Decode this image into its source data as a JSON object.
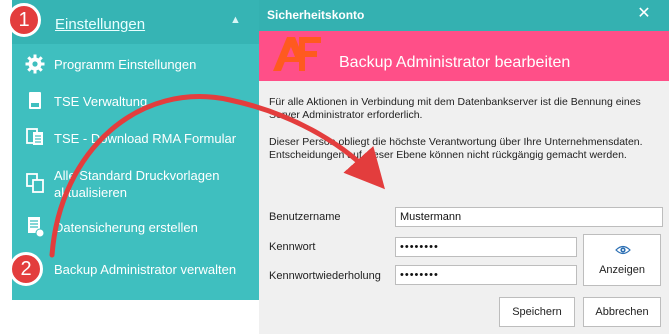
{
  "sidebar": {
    "section_label": "Einstellungen",
    "collapse_icon": "chevron-up-icon",
    "items": [
      {
        "label": "Programm Einstellungen",
        "icon": "gear-icon"
      },
      {
        "label": "TSE Verwaltung",
        "icon": "tse-chip-icon"
      },
      {
        "label": "TSE - Download RMA Formular",
        "icon": "form-download-icon"
      },
      {
        "label": "Alle Standard Druckvorlagen aktualisieren",
        "icon": "copy-templates-icon"
      },
      {
        "label": "Datensicherung erstellen",
        "icon": "backup-document-icon"
      },
      {
        "label": "Backup Administrator verwalten",
        "icon": "database-user-icon"
      }
    ]
  },
  "dialog": {
    "title": "Sicherheitskonto",
    "close_glyph": "✕",
    "banner_title": "Backup Administrator bearbeiten",
    "logo_icon": "af-logo",
    "info_line1": "Für alle Aktionen in Verbindung mit dem Datenbankserver ist die Bennung eines Server Administrator erforderlich.",
    "info_line2": "Dieser Person obliegt die höchste Verantwortung über Ihre Unternehmensdaten. Entscheidungen auf dieser Ebene können nicht rückgängig gemacht werden.",
    "fields": {
      "username_label": "Benutzername",
      "username_value": "Mustermann",
      "password_label": "Kennwort",
      "password_value": "••••••••",
      "password_repeat_label": "Kennwortwiederholung",
      "password_repeat_value": "••••••••"
    },
    "show_button_label": "Anzeigen",
    "show_button_icon": "eye-icon",
    "save_button_label": "Speichern",
    "cancel_button_label": "Abbrechen"
  },
  "callouts": {
    "step1": "1",
    "step2": "2"
  },
  "colors": {
    "sidebar_bg": "#3fbfbf",
    "titlebar_bg": "#34b1b1",
    "banner_bg": "#ff4f88",
    "logo_color": "#ff5a1f",
    "callout_red": "#e33d3d"
  }
}
